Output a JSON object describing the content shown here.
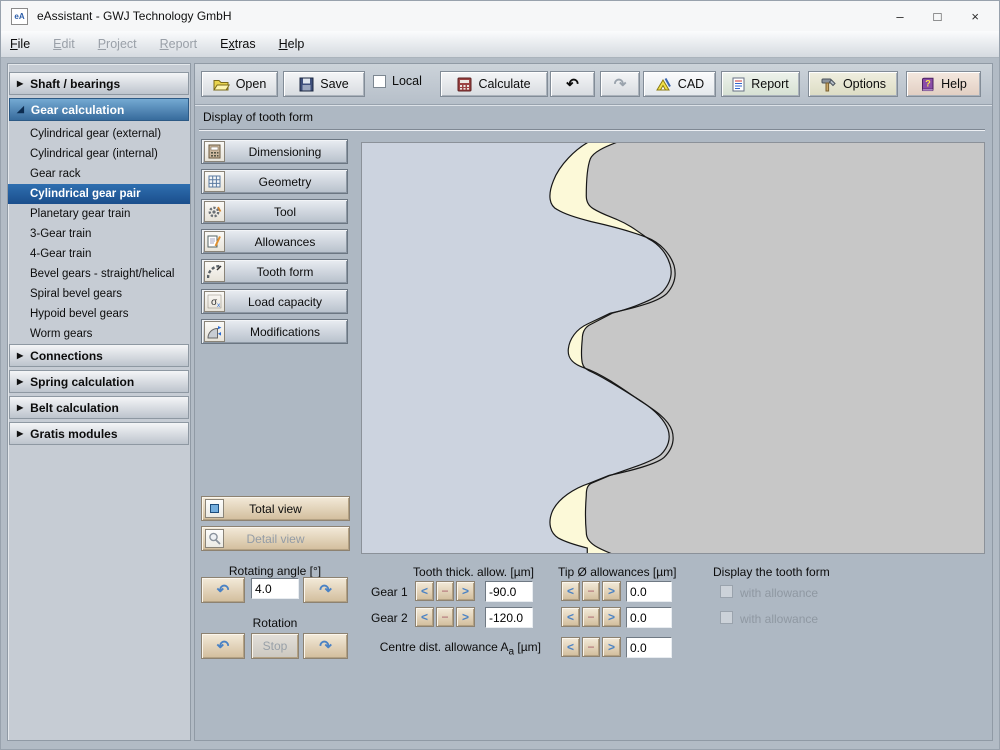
{
  "window": {
    "title": "eAssistant - GWJ Technology GmbH",
    "icon_text": "eA",
    "controls": {
      "minimize": "–",
      "maximize": "□",
      "close": "×"
    }
  },
  "menu": {
    "items": [
      {
        "pre": "",
        "u": "F",
        "post": "ile",
        "enabled": true
      },
      {
        "pre": "",
        "u": "E",
        "post": "dit",
        "enabled": false
      },
      {
        "pre": "",
        "u": "P",
        "post": "roject",
        "enabled": false
      },
      {
        "pre": "",
        "u": "R",
        "post": "eport",
        "enabled": false
      },
      {
        "pre": "E",
        "u": "x",
        "post": "tras",
        "enabled": true
      },
      {
        "pre": "",
        "u": "H",
        "post": "elp",
        "enabled": true
      }
    ]
  },
  "toolbar": {
    "open": "Open",
    "save": "Save",
    "local_label": "Local",
    "calculate": "Calculate",
    "undo_glyph": "↶",
    "redo_glyph": "↷",
    "cad": "CAD",
    "report": "Report",
    "options": "Options",
    "help": "Help"
  },
  "icons": {
    "section_collapsed": "▶",
    "section_expanded": "◢"
  },
  "sidebar": {
    "sections": [
      {
        "label": "Shaft / bearings"
      },
      {
        "label": "Gear calculation",
        "items": [
          "Cylindrical gear (external)",
          "Cylindrical gear (internal)",
          "Gear rack",
          "Cylindrical gear pair",
          "Planetary gear train",
          "3-Gear train",
          "4-Gear train",
          "Bevel gears - straight/helical",
          "Spiral bevel gears",
          "Hypoid bevel gears",
          "Worm gears"
        ],
        "selected_item": "Cylindrical gear pair"
      },
      {
        "label": "Connections"
      },
      {
        "label": "Spring calculation"
      },
      {
        "label": "Belt calculation"
      },
      {
        "label": "Gratis modules"
      }
    ]
  },
  "panel": {
    "title": "Display of tooth form"
  },
  "nav_buttons": {
    "dimensioning": "Dimensioning",
    "geometry": "Geometry",
    "tool": "Tool",
    "allowances": "Allowances",
    "tooth_form": "Tooth form",
    "load_capacity": "Load capacity",
    "modifications": "Modifications"
  },
  "view_buttons": {
    "total": "Total view",
    "detail": "Detail view"
  },
  "display": {
    "bg_left": "#ccd3df",
    "bg_right": "#c7c7c7",
    "band_fill": "#fcf9d8",
    "outline": "#161616"
  },
  "controls": {
    "rotating_angle": {
      "label": "Rotating angle [°]",
      "value": "4.0"
    },
    "rotation": {
      "label": "Rotation",
      "stop_label": "Stop"
    },
    "tooth_thickness": {
      "header": "Tooth thick. allow. [µm]",
      "gear1_label": "Gear 1",
      "gear1_value": "-90.0",
      "gear2_label": "Gear 2",
      "gear2_value": "-120.0"
    },
    "tip_allowances": {
      "header": "Tip Ø allowances [µm]",
      "value1": "0.0",
      "value2": "0.0"
    },
    "centre_distance": {
      "label_main": "Centre dist. allowance A",
      "label_sub": "a",
      "label_unit": " [µm]",
      "value": "0.0"
    },
    "display_options": {
      "header": "Display the tooth form",
      "option1": "with allowance",
      "option2": "with allowance"
    },
    "stepper": {
      "left_glyph": "<",
      "minus_glyph": "−",
      "right_glyph": ">",
      "ccw_glyph": "↶",
      "cw_glyph": "↷"
    }
  }
}
